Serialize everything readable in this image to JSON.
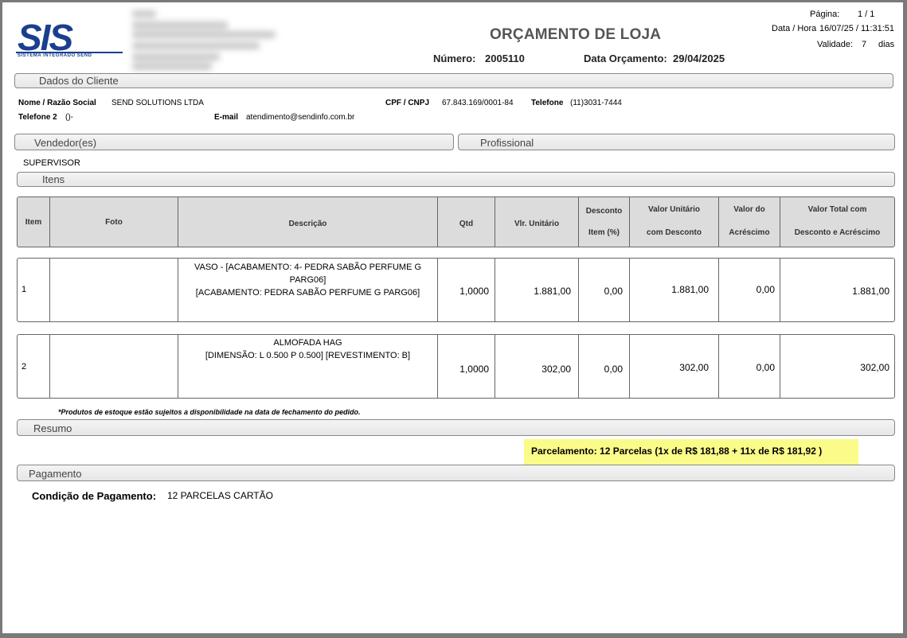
{
  "header": {
    "logo_text": "SIS",
    "logo_subtitle": "SISTEMA INTEGRADO SEND",
    "title": "ORÇAMENTO DE LOJA",
    "numero_label": "Número:",
    "numero_value": "2005110",
    "data_orcamento_label": "Data Orçamento:",
    "data_orcamento_value": "29/04/2025",
    "pagina_label": "Página:",
    "pagina_value": "1 / 1",
    "data_hora_label": "Data / Hora",
    "data_hora_value": "16/07/25 / 11:31:51",
    "validade_label": "Validade:",
    "validade_value": "7",
    "validade_unit": "dias"
  },
  "cliente": {
    "section_label": "Dados do Cliente",
    "nome_label": "Nome / Razão Social",
    "nome_value": "SEND SOLUTIONS LTDA",
    "cpf_label": "CPF / CNPJ",
    "cpf_value": "67.843.169/0001-84",
    "telefone_label": "Telefone",
    "telefone_value": "(11)3031-7444",
    "telefone2_label": "Telefone 2",
    "telefone2_value": "()-",
    "email_label": "E-mail",
    "email_value": "atendimento@sendinfo.com.br"
  },
  "vendedores": {
    "section_label": "Vendedor(es)",
    "profissional_label": "Profissional",
    "vendedor_value": "SUPERVISOR"
  },
  "itens": {
    "section_label": "Itens",
    "columns": {
      "item": "Item",
      "foto": "Foto",
      "descricao": "Descrição",
      "qtd": "Qtd",
      "vlr_unitario": "Vlr. Unitário",
      "desconto_l1": "Desconto",
      "desconto_l2": "Item (%)",
      "vu_desc_l1": "Valor Unitário",
      "vu_desc_l2": "com Desconto",
      "acrescimo_l1": "Valor do",
      "acrescimo_l2": "Acréscimo",
      "total_l1": "Valor Total com",
      "total_l2": "Desconto e Acréscimo"
    },
    "rows": [
      {
        "item": "1",
        "desc_l1": "VASO - [ACABAMENTO:   4- PEDRA SABÃO PERFUME G",
        "desc_l2": "PARG06]",
        "desc_l3": "[ACABAMENTO: PEDRA SABÃO PERFUME G PARG06]",
        "qtd": "1,0000",
        "vlr_unitario": "1.881,00",
        "desconto": "0,00",
        "vu_desc": "1.881,00",
        "acrescimo": "0,00",
        "total": "1.881,00"
      },
      {
        "item": "2",
        "desc_l1": "ALMOFADA HAG",
        "desc_l2": "[DIMENSÃO: L 0.500 P 0.500] [REVESTIMENTO: B]",
        "desc_l3": "",
        "qtd": "1,0000",
        "vlr_unitario": "302,00",
        "desconto": "0,00",
        "vu_desc": "302,00",
        "acrescimo": "0,00",
        "total": "302,00"
      }
    ],
    "footnote": "*Produtos de estoque estão sujeitos a disponibilidade na data de fechamento do pedido."
  },
  "resumo": {
    "section_label": "Resumo",
    "parcelamento": "Parcelamento: 12 Parcelas (1x de R$ 181,88 + 11x de R$ 181,92 )",
    "highlight_color": "#fbfb8a"
  },
  "pagamento": {
    "section_label": "Pagamento",
    "condicao_label": "Condição de Pagamento:",
    "condicao_value": "12 PARCELAS CARTÃO"
  },
  "colors": {
    "logo_blue": "#1b3f8f",
    "title_gray": "#555555",
    "header_fill": "#dcdcdc"
  }
}
